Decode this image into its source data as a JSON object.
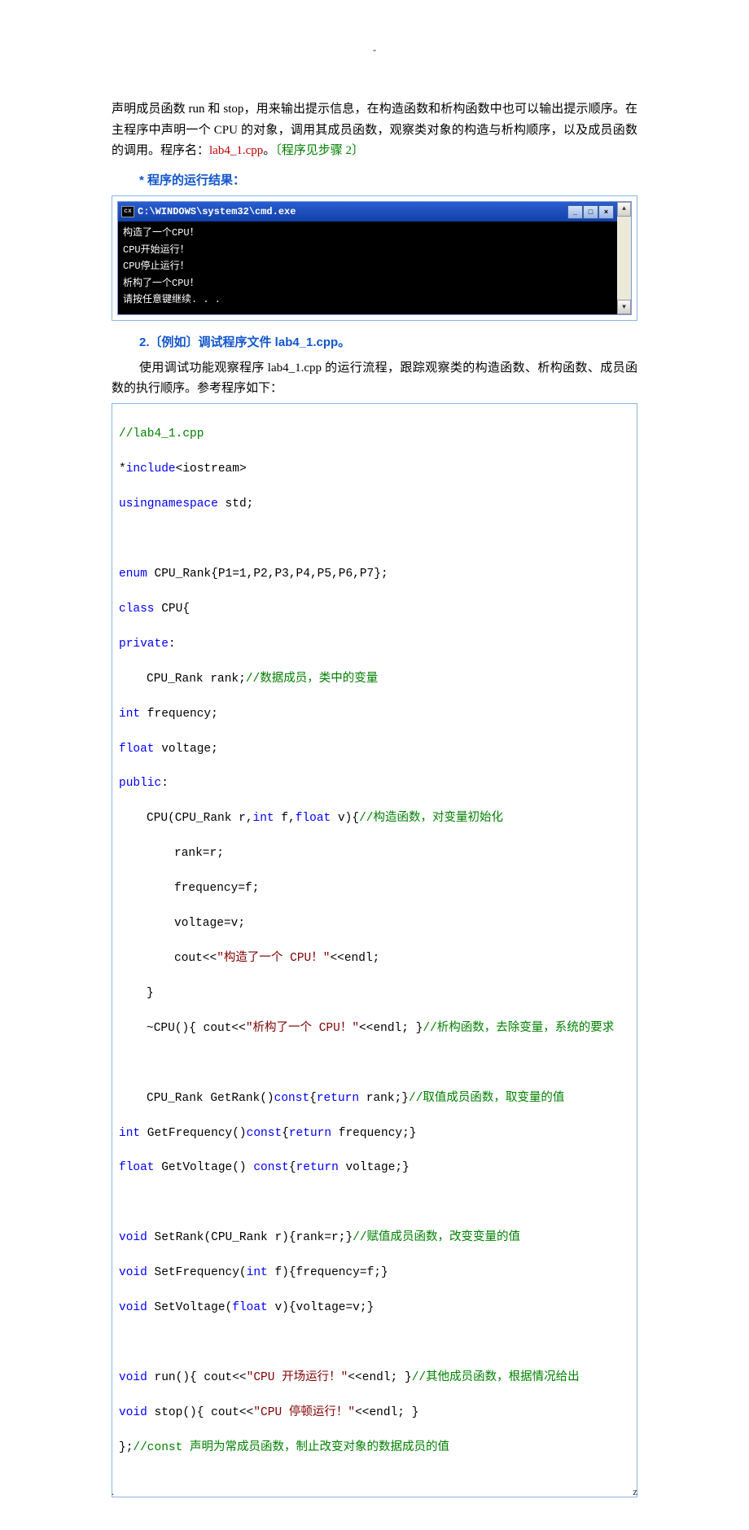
{
  "topmark": "-",
  "para1_a": "声明成员函数 run 和 stop，用来输出提示信息，在构造函数和析构函数中也可以输出提示顺序。在主程序中声明一个 CPU 的对象，调用其成员函数，观察类对象的构造与析构顺序，以及成员函数的调用。程序名：",
  "para1_red": "lab4_1.cpp",
  "para1_b": "。",
  "para1_green": "〔程序见步骤 2〕",
  "sec1": "* 程序的运行结果：",
  "cmd": {
    "title": "C:\\WINDOWS\\system32\\cmd.exe",
    "lines": "构造了一个CPU！\nCPU开始运行！\nCPU停止运行！\n析构了一个CPU！\n请按任意键继续. . ."
  },
  "sec2": "2.〔例如〕调试程序文件 lab4_1.cpp。",
  "para2": "使用调试功能观察程序 lab4_1.cpp 的运行流程，跟踪观察类的构造函数、析构函数、成员函数的执行顺序。参考程序如下：",
  "code": {
    "l1": "//lab4_1.cpp",
    "l2a": "*",
    "l2b": "include",
    "l2c": "<iostream>",
    "l3a": "using",
    "l3b": "namespace",
    "l3c": " std;",
    "l4a": "enum",
    "l4b": " CPU_Rank{P1=1,P2,P3,P4,P5,P6,P7};",
    "l5a": "class",
    "l5b": " CPU{",
    "l6": "private",
    "l6b": ":",
    "l7a": "CPU_Rank rank;",
    "l7b": "//数据成员，类中的变量",
    "l8a": "int",
    "l8b": " frequency;",
    "l9a": "float",
    "l9b": " voltage;",
    "l10": "public",
    "l10b": ":",
    "l11a": "CPU(CPU_Rank r,",
    "l11b": "int",
    "l11c": " f,",
    "l11d": "float",
    "l11e": " v){",
    "l11f": "//构造函数，对变量初始化",
    "l12": "rank=r;",
    "l13": "frequency=f;",
    "l14": "voltage=v;",
    "l15a": "cout<<",
    "l15b": "\"构造了一个 CPU！\"",
    "l15c": "<<endl;",
    "l16": "}",
    "l17a": "~CPU(){ cout<<",
    "l17b": "\"析构了一个 CPU！\"",
    "l17c": "<<endl; }",
    "l17d": "//析构函数，去除变量，系统的要求",
    "l18a": "CPU_Rank GetRank()",
    "l18b": "const",
    "l18c": "{",
    "l18d": "return",
    "l18e": " rank;}",
    "l18f": "//取值成员函数，取变量的值",
    "l19a": "int",
    "l19b": " GetFrequency()",
    "l19c": "const",
    "l19d": "{",
    "l19e": "return",
    "l19f": " frequency;}",
    "l20a": "float",
    "l20b": " GetVoltage() ",
    "l20c": "const",
    "l20d": "{",
    "l20e": "return",
    "l20f": " voltage;}",
    "l21a": "void",
    "l21b": " SetRank(CPU_Rank r){rank=r;}",
    "l21c": "//赋值成员函数，改变变量的值",
    "l22a": "void",
    "l22b": " SetFrequency(",
    "l22c": "int",
    "l22d": " f){frequency=f;}",
    "l23a": "void",
    "l23b": " SetVoltage(",
    "l23c": "float",
    "l23d": " v){voltage=v;}",
    "l24a": "void",
    "l24b": " run(){ cout<<",
    "l24c": "\"CPU 开场运行！\"",
    "l24d": "<<endl; }",
    "l24e": "//其他成员函数，根据情况给出",
    "l25a": "void",
    "l25b": " stop(){ cout<<",
    "l25c": "\"CPU 停顿运行！\"",
    "l25d": "<<endl; }",
    "l26a": "};",
    "l26b": "//const 声明为常成员函数，制止改变对象的数据成员的值"
  },
  "footer": {
    "left": ".",
    "right": "z"
  }
}
